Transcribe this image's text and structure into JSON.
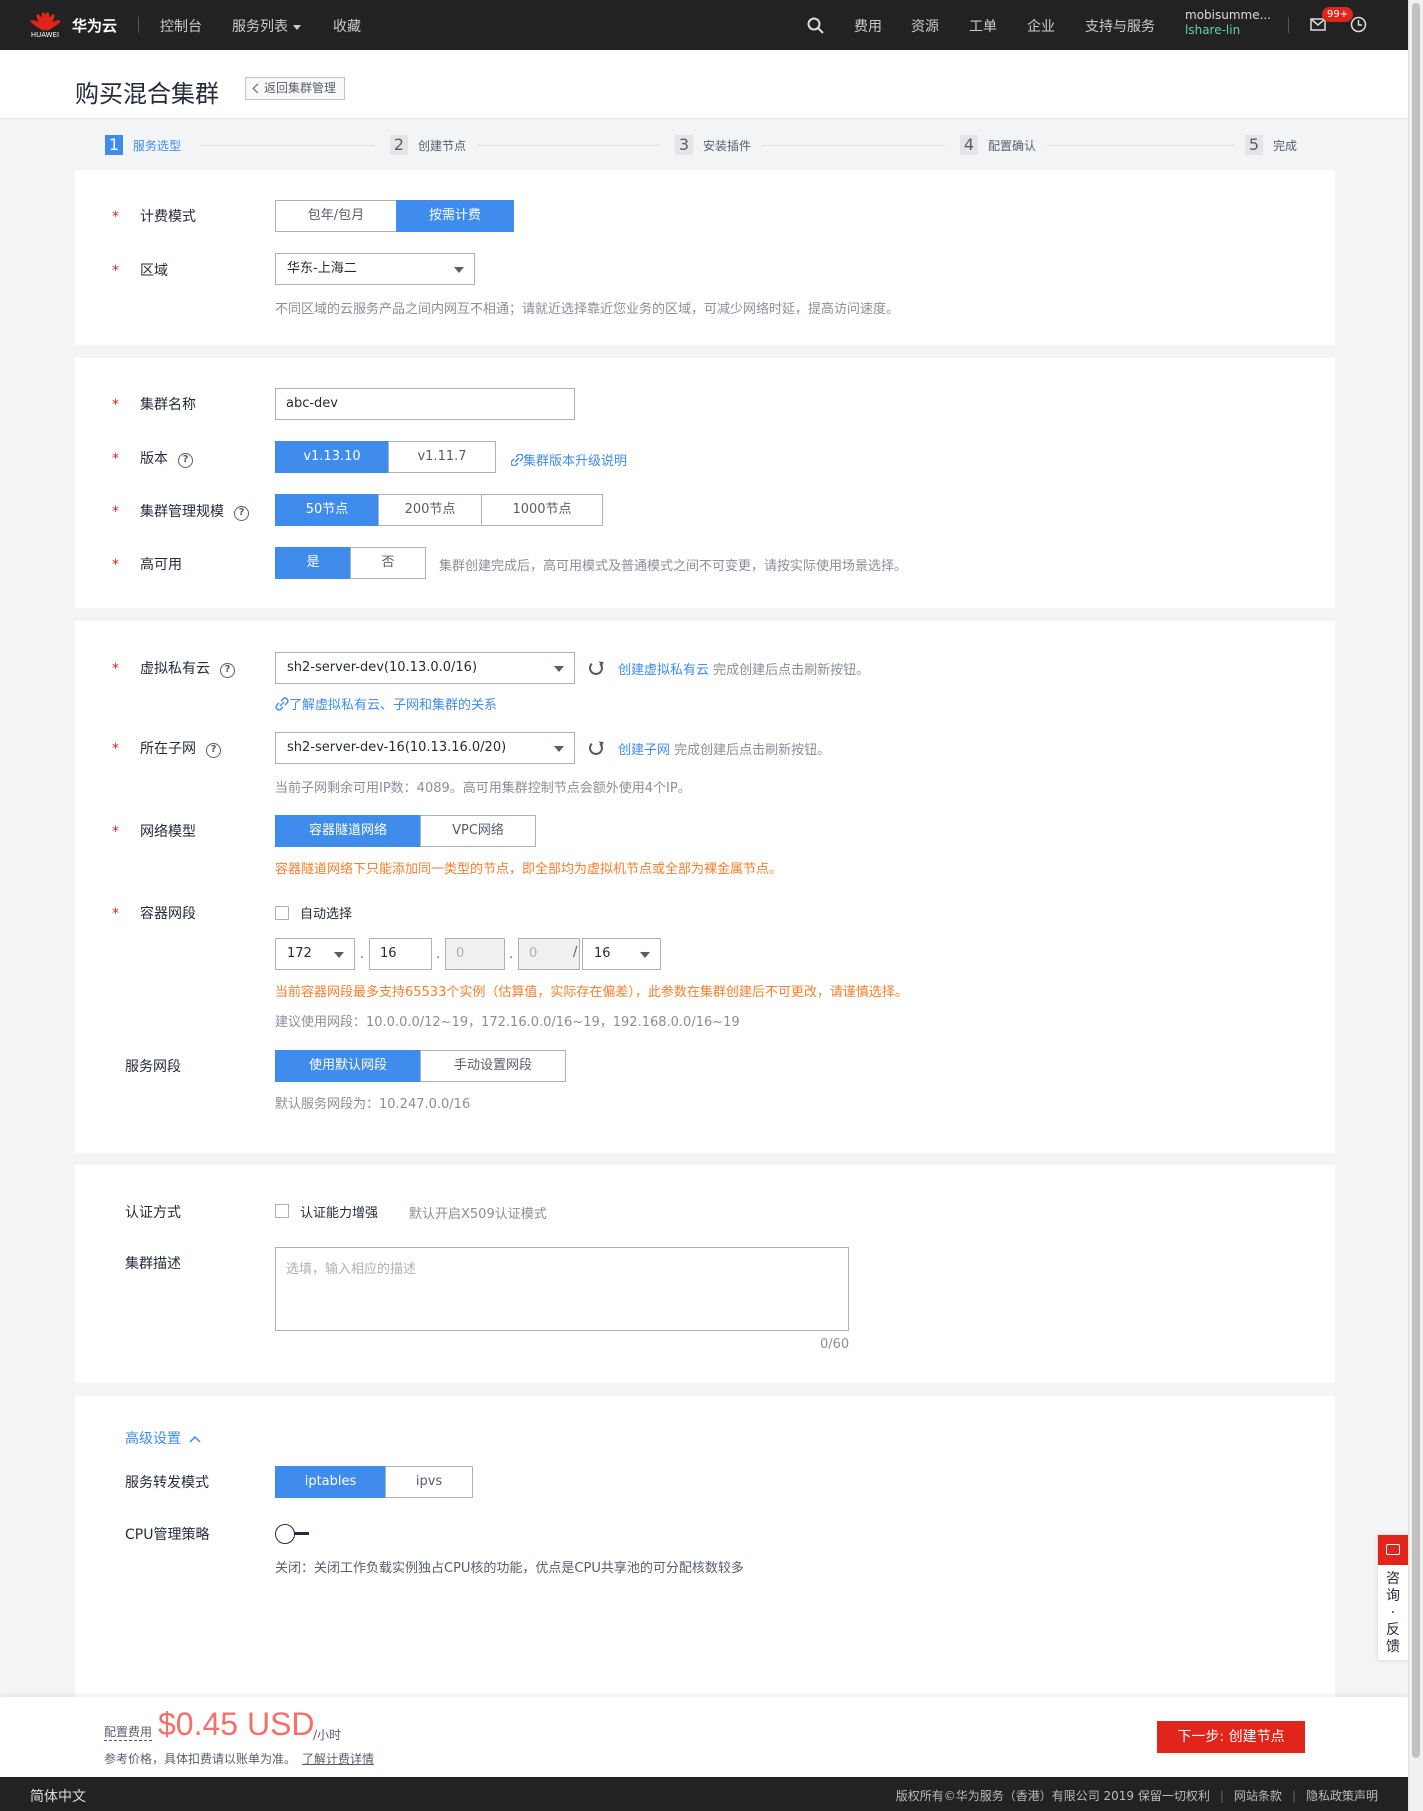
{
  "topbar": {
    "logo_text": "HUAWEI",
    "brand": "华为云",
    "nav": [
      "控制台",
      "服务列表",
      "收藏"
    ],
    "right_nav": [
      "费用",
      "资源",
      "工单",
      "企业",
      "支持与服务"
    ],
    "user_name": "mobisumme...",
    "user_sub": "lshare-lin",
    "badge": "99+"
  },
  "header": {
    "title": "购买混合集群",
    "back": "返回集群管理"
  },
  "steps": [
    {
      "num": "1",
      "label": "服务选型"
    },
    {
      "num": "2",
      "label": "创建节点"
    },
    {
      "num": "3",
      "label": "安装插件"
    },
    {
      "num": "4",
      "label": "配置确认"
    },
    {
      "num": "5",
      "label": "完成"
    }
  ],
  "billing": {
    "label": "计费模式",
    "options": [
      "包年/包月",
      "按需计费"
    ],
    "selected": "按需计费"
  },
  "region": {
    "label": "区域",
    "value": "华东-上海二",
    "hint": "不同区域的云服务产品之间内网互不相通；请就近选择靠近您业务的区域，可减少网络时延，提高访问速度。"
  },
  "cluster_name": {
    "label": "集群名称",
    "value": "abc-dev"
  },
  "version": {
    "label": "版本",
    "options": [
      "v1.13.10",
      "v1.11.7"
    ],
    "selected": "v1.13.10",
    "link": "集群版本升级说明"
  },
  "scale": {
    "label": "集群管理规模",
    "options": [
      "50节点",
      "200节点",
      "1000节点"
    ],
    "selected": "50节点"
  },
  "ha": {
    "label": "高可用",
    "options": [
      "是",
      "否"
    ],
    "selected": "是",
    "hint": "集群创建完成后，高可用模式及普通模式之间不可变更，请按实际使用场景选择。"
  },
  "vpc": {
    "label": "虚拟私有云",
    "value": "sh2-server-dev(10.13.0.0/16)",
    "create_link": "创建虚拟私有云",
    "create_hint": "完成创建后点击刷新按钮。",
    "learn_link": "了解虚拟私有云、子网和集群的关系"
  },
  "subnet": {
    "label": "所在子网",
    "value": "sh2-server-dev-16(10.13.16.0/20)",
    "create_link": "创建子网",
    "create_hint": "完成创建后点击刷新按钮。",
    "hint": "当前子网剩余可用IP数：4089。高可用集群控制节点会额外使用4个IP。"
  },
  "network_model": {
    "label": "网络模型",
    "options": [
      "容器隧道网络",
      "VPC网络"
    ],
    "selected": "容器隧道网络",
    "warning": "容器隧道网络下只能添加同一类型的节点，即全部均为虚拟机节点或全部为裸金属节点。"
  },
  "container_cidr": {
    "label": "容器网段",
    "auto_label": "自动选择",
    "octet1": "172",
    "octet2": "16",
    "octet3": "0",
    "octet4": "0",
    "mask": "16",
    "dot": ".",
    "slash": "/",
    "warning": "当前容器网段最多支持65533个实例（估算值，实际存在偏差），此参数在集群创建后不可更改，请谨慎选择。",
    "suggest": "建议使用网段：10.0.0.0/12~19，172.16.0.0/16~19，192.168.0.0/16~19"
  },
  "service_cidr": {
    "label": "服务网段",
    "options": [
      "使用默认网段",
      "手动设置网段"
    ],
    "selected": "使用默认网段",
    "hint": "默认服务网段为：10.247.0.0/16"
  },
  "auth": {
    "label": "认证方式",
    "checkbox": "认证能力增强",
    "hint": "默认开启X509认证模式"
  },
  "desc": {
    "label": "集群描述",
    "placeholder": "选填，输入相应的描述",
    "counter": "0/60"
  },
  "advanced": {
    "toggle": "高级设置",
    "forward_label": "服务转发模式",
    "forward_options": [
      "iptables",
      "ipvs"
    ],
    "forward_selected": "iptables",
    "cpu_label": "CPU管理策略",
    "cpu_on": false,
    "cpu_hint": "关闭：关闭工作负载实例独占CPU核的功能，优点是CPU共享池的可分配核数较多"
  },
  "fee": {
    "label": "配置费用",
    "price": "$0.45 USD",
    "unit": "/小时",
    "note": "参考价格，具体扣费请以账单为准。",
    "note_link": "了解计费详情",
    "next": "下一步: 创建节点"
  },
  "side": {
    "text1": "咨",
    "text2": "询",
    "text3": "·",
    "text4": "反",
    "text5": "馈"
  },
  "footer": {
    "lang": "简体中文",
    "copyright": "版权所有©华为服务（香港）有限公司 2019 保留一切权利",
    "terms": "网站条款",
    "privacy": "隐私政策声明"
  },
  "colors": {
    "accent": "#3f8ced",
    "brand": "#e1251b",
    "warning": "#fa7e2b"
  }
}
